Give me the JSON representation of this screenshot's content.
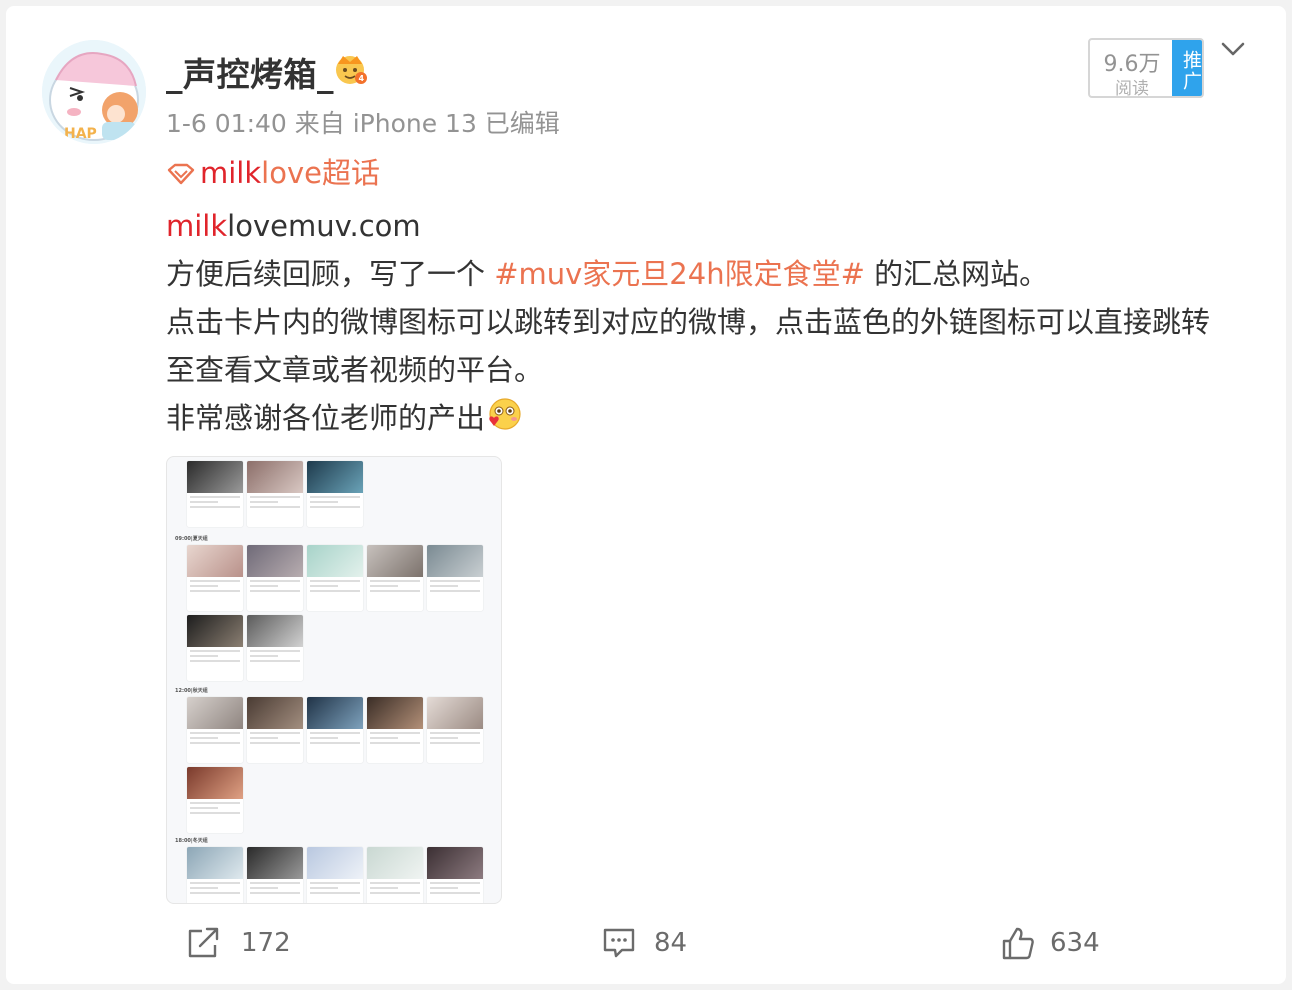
{
  "post": {
    "username": "_声控烤箱_",
    "meta": "1-6 01:40  来自 iPhone 13  已编辑",
    "reads_count": "9.6万",
    "reads_label": "阅读",
    "promote_label": "推广",
    "topic_prefix": "milk",
    "topic_suffix": "love超话",
    "link_prefix": "milk",
    "link_suffix": "lovemuv.com",
    "line1_a": "方便后续回顾，写了一个 ",
    "hashtag": "#muv家元旦24h限定食堂#",
    "line1_b": " 的汇总网站。",
    "line2": "点击卡片内的微博图标可以跳转到对应的微博，点击蓝色的外链图标可以直接跳转",
    "line3": "至查看文章或者视频的平台。",
    "line4": "非常感谢各位老师的产出"
  },
  "thumbnail": {
    "sections": [
      "09:00|夏天组",
      "12:00|秋天组",
      "18:00|冬天组"
    ]
  },
  "actions": {
    "repost_count": "172",
    "comment_count": "84",
    "like_count": "634"
  },
  "colors": {
    "accent_orange": "#eb7350",
    "brand_red": "#e0242b",
    "promote_blue": "#2fa3ec",
    "text_gray": "#939393"
  },
  "icons": {
    "repost": "share-icon",
    "comment": "comment-icon",
    "like": "thumbs-up-icon",
    "topic": "diamond-icon",
    "menu": "chevron-down-icon",
    "badge": "crown-icon"
  }
}
